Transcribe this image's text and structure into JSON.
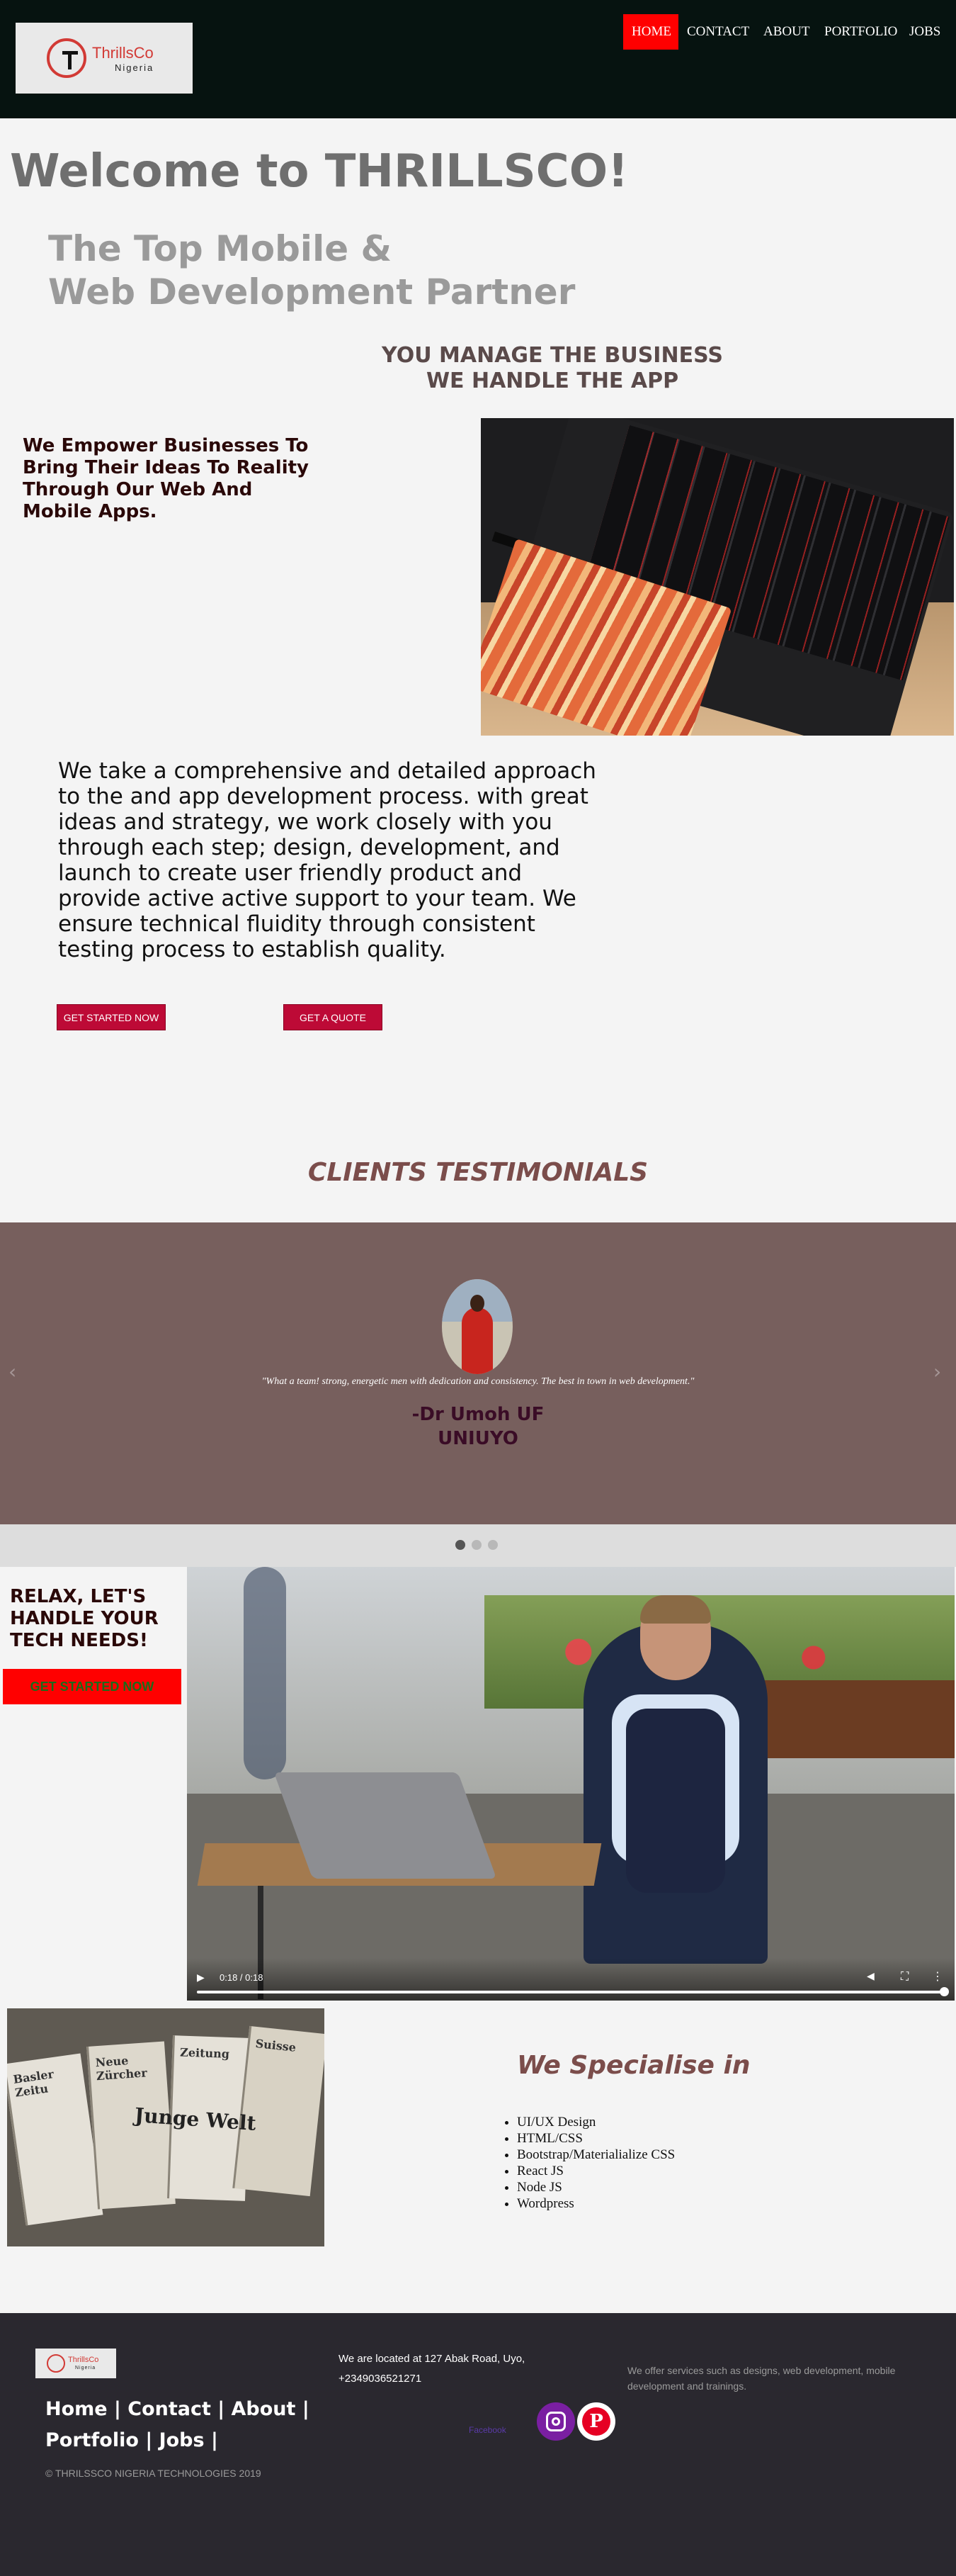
{
  "brand": {
    "logo_name": "ThrillsCo",
    "logo_sub": "Nigeria"
  },
  "nav": {
    "home": "HOME",
    "contact": "CONTACT",
    "about": "ABOUT",
    "portfolio": "PORTFOLIO",
    "jobs": "JOBS",
    "active": "HOME",
    "active_color": "#ff0000"
  },
  "hero": {
    "welcome": "Welcome to THRILLSCO!",
    "tagline_line1": "The Top Mobile &",
    "tagline_line2": "Web Development Partner",
    "slogan_line1": "YOU MANAGE THE BUSINESS",
    "slogan_line2": "WE HANDLE THE APP",
    "empower": "We Empower Businesses To Bring Their Ideas To Reality Through Our Web And Mobile Apps."
  },
  "about": {
    "text": "We take a comprehensive and detailed approach to the and app development process. with great ideas and strategy, we work closely with you through each step; design, development, and launch to create user friendly product and provide active active support to your team. We ensure technical fluidity through consistent testing process to establish quality.",
    "get_started": "GET STARTED NOW",
    "get_quote": "GET A QUOTE",
    "button_color": "#bd0a36"
  },
  "testimonials": {
    "title": "CLIENTS TESTIMONIALS",
    "quote": "\"What a team! strong, energetic men with dedication and consistency. The best in town in web development.\"",
    "name": "-Dr Umoh UF",
    "org": "UNIUYO",
    "prev_icon": "‹",
    "next_icon": "›",
    "slide_count": 3,
    "active_slide": 1,
    "background": "#775f5d"
  },
  "cta": {
    "relax": "RELAX, LET'S HANDLE YOUR TECH NEEDS!",
    "button": "GET STARTED NOW"
  },
  "video": {
    "time": "0:18 / 0:18",
    "progress": 1.0,
    "play_icon": "▶",
    "mute_icon": "◀",
    "fullscreen_icon": "⛶",
    "more_icon": "⋮"
  },
  "specialise": {
    "title": "We Specialise in",
    "items": [
      "UI/UX Design",
      "HTML/CSS",
      "Bootstrap/Materialialize CSS",
      "React JS",
      "Node JS",
      "Wordpress"
    ],
    "newspaper_heads": [
      "Basler Zeitu",
      "Neue Zürcher",
      "Zeitung",
      "Suisse"
    ],
    "newspaper_caption": "Junge Welt"
  },
  "footer": {
    "links_line1": "Home | Contact | About |",
    "links_line2": "Portfolio | Jobs |",
    "copyright": "© THRILSSCO NIGERIA TECHNOLOGIES 2019",
    "address_line1": "We are located at 127 Abak Road, Uyo,",
    "address_line2": "+2349036521271",
    "services": "We offer services such as designs, web development, mobile development and trainings.",
    "facebook_alt": "Facebook",
    "pinterest_glyph": "P",
    "background": "#2a282f"
  }
}
